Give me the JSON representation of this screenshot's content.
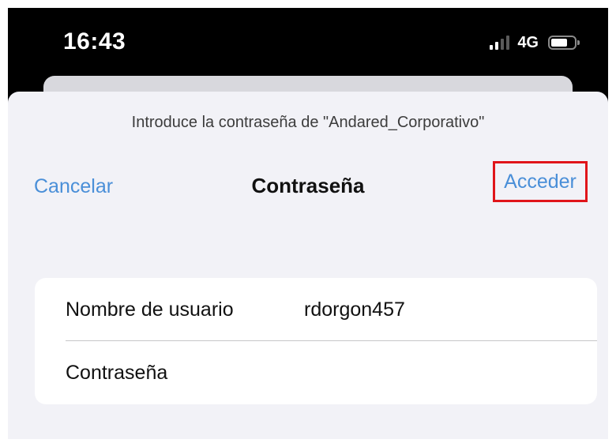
{
  "status_bar": {
    "time": "16:43",
    "network": "4G",
    "signal_icon": "cellular-signal-icon",
    "battery_icon": "battery-icon"
  },
  "sheet": {
    "prompt": "Introduce la contraseña de \"Andared_Corporativo\"",
    "cancel_label": "Cancelar",
    "title": "Contraseña",
    "join_label": "Acceder",
    "highlight_color": "#e0151a",
    "accent_color": "#4a8fd8"
  },
  "form": {
    "username_label": "Nombre de usuario",
    "username_value": "rdorgon457",
    "password_label": "Contraseña",
    "password_value": ""
  }
}
